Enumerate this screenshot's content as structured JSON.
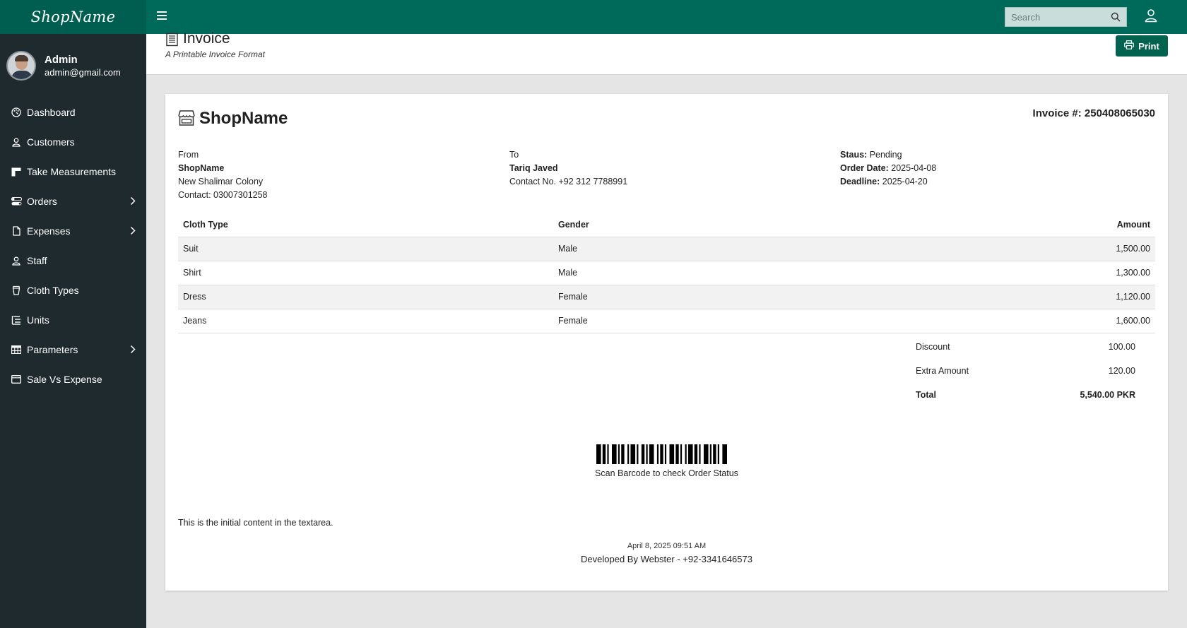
{
  "app": {
    "brand": "ShopName"
  },
  "topbar": {
    "search_placeholder": "Search"
  },
  "user": {
    "name": "Admin",
    "email": "admin@gmail.com"
  },
  "sidebar": {
    "items": [
      {
        "label": "Dashboard",
        "icon": "palette-icon",
        "has_submenu": false
      },
      {
        "label": "Customers",
        "icon": "person-icon",
        "has_submenu": false
      },
      {
        "label": "Take Measurements",
        "icon": "layout-icon",
        "has_submenu": false
      },
      {
        "label": "Orders",
        "icon": "toggles-icon",
        "has_submenu": true
      },
      {
        "label": "Expenses",
        "icon": "file-icon",
        "has_submenu": true
      },
      {
        "label": "Staff",
        "icon": "person-icon",
        "has_submenu": false
      },
      {
        "label": "Cloth Types",
        "icon": "cup-icon",
        "has_submenu": false
      },
      {
        "label": "Units",
        "icon": "list-nested-icon",
        "has_submenu": false
      },
      {
        "label": "Parameters",
        "icon": "table-icon",
        "has_submenu": true
      },
      {
        "label": "Sale Vs Expense",
        "icon": "window-icon",
        "has_submenu": false
      }
    ]
  },
  "page": {
    "title": "Invoice",
    "subtitle": "A Printable Invoice Format",
    "print_label": "Print"
  },
  "invoice": {
    "shop_name": "ShopName",
    "number": "Invoice #: 250408065030",
    "from": {
      "heading": "From",
      "name": "ShopName",
      "address": "New Shalimar Colony",
      "contact": "Contact: 03007301258"
    },
    "to": {
      "heading": "To",
      "name": "Tariq Javed",
      "contact": "Contact No. +92 312 7788991"
    },
    "status": {
      "status_label": "Staus:",
      "status_value": "Pending",
      "order_date_label": "Order Date:",
      "order_date_value": "2025-04-08",
      "deadline_label": "Deadline:",
      "deadline_value": "2025-04-20"
    },
    "columns": [
      "Cloth Type",
      "Gender",
      "Amount"
    ],
    "rows": [
      {
        "type": "Suit",
        "gender": "Male",
        "amount": "1,500.00"
      },
      {
        "type": "Shirt",
        "gender": "Male",
        "amount": "1,300.00"
      },
      {
        "type": "Dress",
        "gender": "Female",
        "amount": "1,120.00"
      },
      {
        "type": "Jeans",
        "gender": "Female",
        "amount": "1,600.00"
      }
    ],
    "totals": [
      {
        "label": "Discount",
        "value": "100.00"
      },
      {
        "label": "Extra Amount",
        "value": "120.00"
      },
      {
        "label": "Total",
        "value": "5,540.00 PKR"
      }
    ],
    "barcode_caption": "Scan Barcode to check Order Status",
    "note": "This is the initial content in the textarea.",
    "timestamp": "April 8, 2025 09:51 AM",
    "developer": "Developed By Webster - +92-3341646573"
  },
  "colors": {
    "topbar": "#006a5a",
    "sidebar": "#1f2a2f",
    "accent_button": "#00624f"
  }
}
